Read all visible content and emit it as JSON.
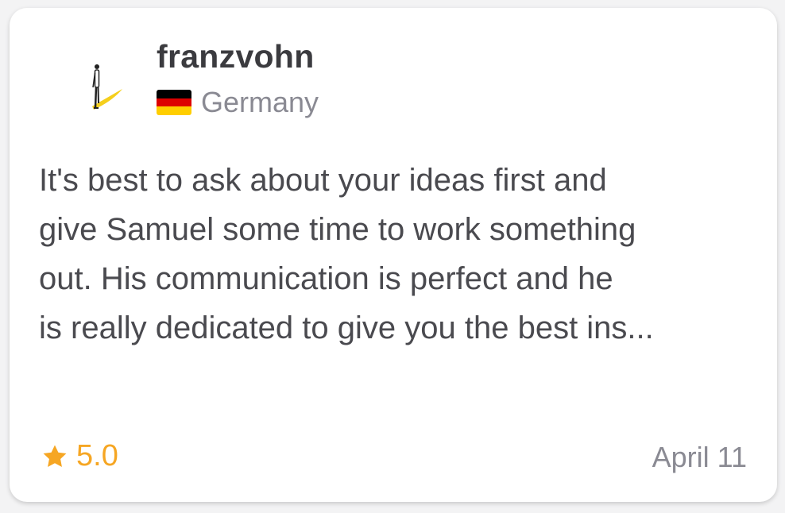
{
  "review": {
    "username": "franzvohn",
    "country": "Germany",
    "flag_colors": [
      "#000000",
      "#dd0000",
      "#ffce00"
    ],
    "text_lines": [
      "It's best to ask about your ideas first and",
      "give Samuel some time to work something",
      "out. His communication is perfect and he",
      "is really dedicated to give you the best ins..."
    ],
    "rating": "5.0",
    "date": "April 11",
    "icons": {
      "avatar": "person-with-yellow-shadow-avatar",
      "flag": "germany-flag-icon",
      "star": "star-icon"
    },
    "colors": {
      "rating": "#f6a623",
      "muted": "#8a8a93",
      "text": "#4a4a4f"
    }
  }
}
